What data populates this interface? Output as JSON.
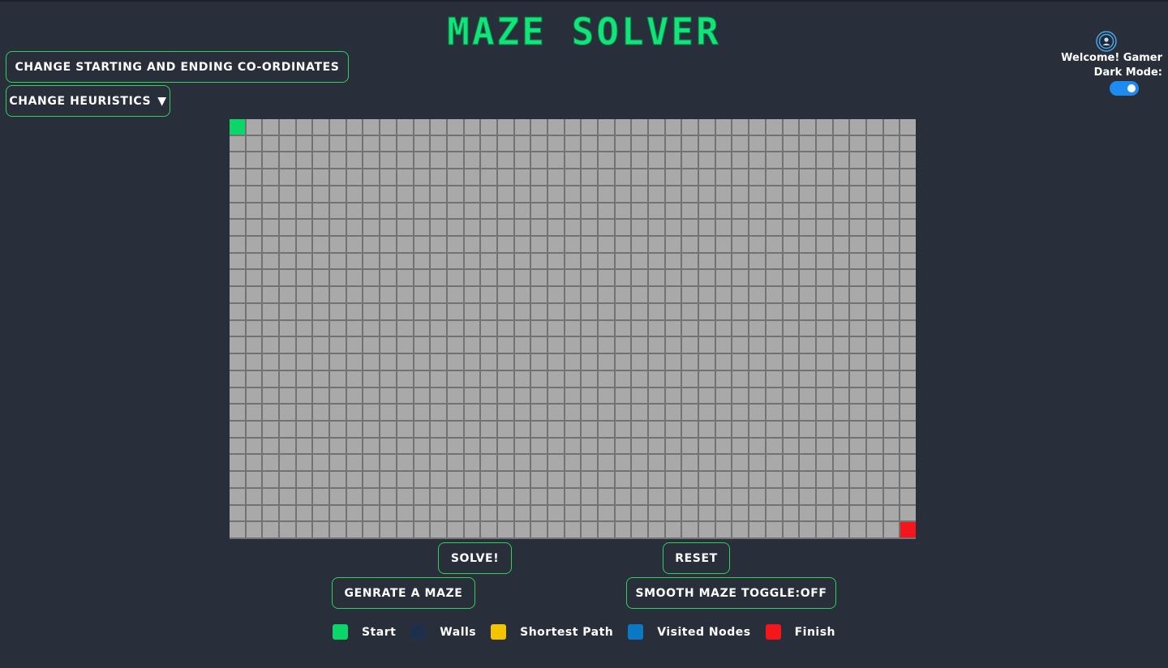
{
  "app": {
    "title": "MAZE SOLVER"
  },
  "controls": {
    "change_coords_label": "CHANGE STARTING AND ENDING CO-ORDINATES",
    "change_heuristics_label": "CHANGE HEURISTICS",
    "heuristics_caret": "▼",
    "solve_label": "SOLVE!",
    "reset_label": "RESET",
    "generate_label": "GENRATE A MAZE",
    "smooth_label": "SMOOTH MAZE TOGGLE:OFF"
  },
  "user": {
    "welcome": "Welcome! Gamer",
    "dark_mode_label": "Dark Mode:",
    "dark_mode_on": true
  },
  "grid": {
    "columns": 41,
    "rows": 25,
    "start": [
      0,
      0
    ],
    "finish": [
      24,
      40
    ]
  },
  "legend": [
    {
      "label": "Start",
      "color": "#0ad66a"
    },
    {
      "label": "Walls",
      "color": "#1d2f4a"
    },
    {
      "label": "Shortest Path",
      "color": "#f5c400"
    },
    {
      "label": "Visited Nodes",
      "color": "#0b78c4"
    },
    {
      "label": "Finish",
      "color": "#f5161c"
    }
  ],
  "colors": {
    "background": "#282f3b",
    "accent": "#12e37a",
    "button_border": "#2fcf5a",
    "cell": "#a9a9a9",
    "toggle": "#1e8bf0"
  }
}
